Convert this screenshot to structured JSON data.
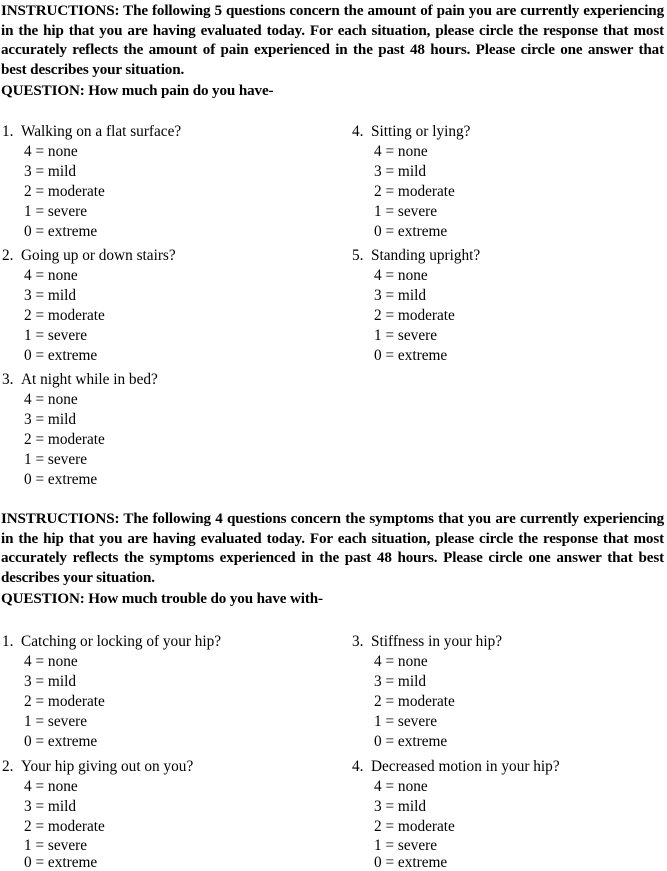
{
  "sections": [
    {
      "id": "pain",
      "instructions": "INSTRUCTIONS: The following 5 questions concern the amount of pain you are currently experiencing in the hip that you are having evaluated today. For each situation, please circle the response that most accurately reflects the amount of pain experienced in the past 48 hours. Please circle one answer that best describes your situation.",
      "question_header": "QUESTION: How much pain do you have-",
      "questions": [
        {
          "number": "1.",
          "text": "Walking on a flat surface?",
          "options": [
            "4 = none",
            "3 = mild",
            "2 = moderate",
            "1 = severe",
            "0 = extreme"
          ]
        },
        {
          "number": "2.",
          "text": "Going up or down stairs?",
          "options": [
            "4 = none",
            "3 = mild",
            "2 = moderate",
            "1 = severe",
            "0 = extreme"
          ]
        },
        {
          "number": "3.",
          "text": "At night while in bed?",
          "options": [
            "4 = none",
            "3 = mild",
            "2 = moderate",
            "1 = severe",
            "0 = extreme"
          ]
        },
        {
          "number": "4.",
          "text": "Sitting or lying?",
          "options": [
            "4 = none",
            "3 = mild",
            "2 = moderate",
            "1 = severe",
            "0 = extreme"
          ]
        },
        {
          "number": "5.",
          "text": "Standing upright?",
          "options": [
            "4 = none",
            "3 = mild",
            "2 = moderate",
            "1 = severe",
            "0 = extreme"
          ]
        }
      ]
    },
    {
      "id": "symptoms",
      "instructions": "INSTRUCTIONS: The following 4 questions concern the symptoms that you are currently experiencing in the hip that you are having evaluated today. For each situation, please circle the response that most accurately reflects the symptoms experienced in the past 48 hours. Please circle one answer that best describes your situation.",
      "question_header": "QUESTION: How much trouble do you have with-",
      "questions": [
        {
          "number": "1.",
          "text": "Catching or locking of your hip?",
          "options": [
            "4 = none",
            "3 = mild",
            "2 = moderate",
            "1 = severe",
            "0 = extreme"
          ]
        },
        {
          "number": "2.",
          "text": "Your hip giving out on you?",
          "options": [
            "4 = none",
            "3 = mild",
            "2 = moderate",
            "1 = severe",
            "0 = extreme"
          ]
        },
        {
          "number": "3.",
          "text": "Stiffness in your hip?",
          "options": [
            "4 = none",
            "3 = mild",
            "2 = moderate",
            "1 = severe",
            "0 = extreme"
          ]
        },
        {
          "number": "4.",
          "text": "Decreased motion in your hip?",
          "options": [
            "4 = none",
            "3 = mild",
            "2 = moderate",
            "1 = severe",
            "0 = extreme"
          ]
        }
      ]
    }
  ]
}
